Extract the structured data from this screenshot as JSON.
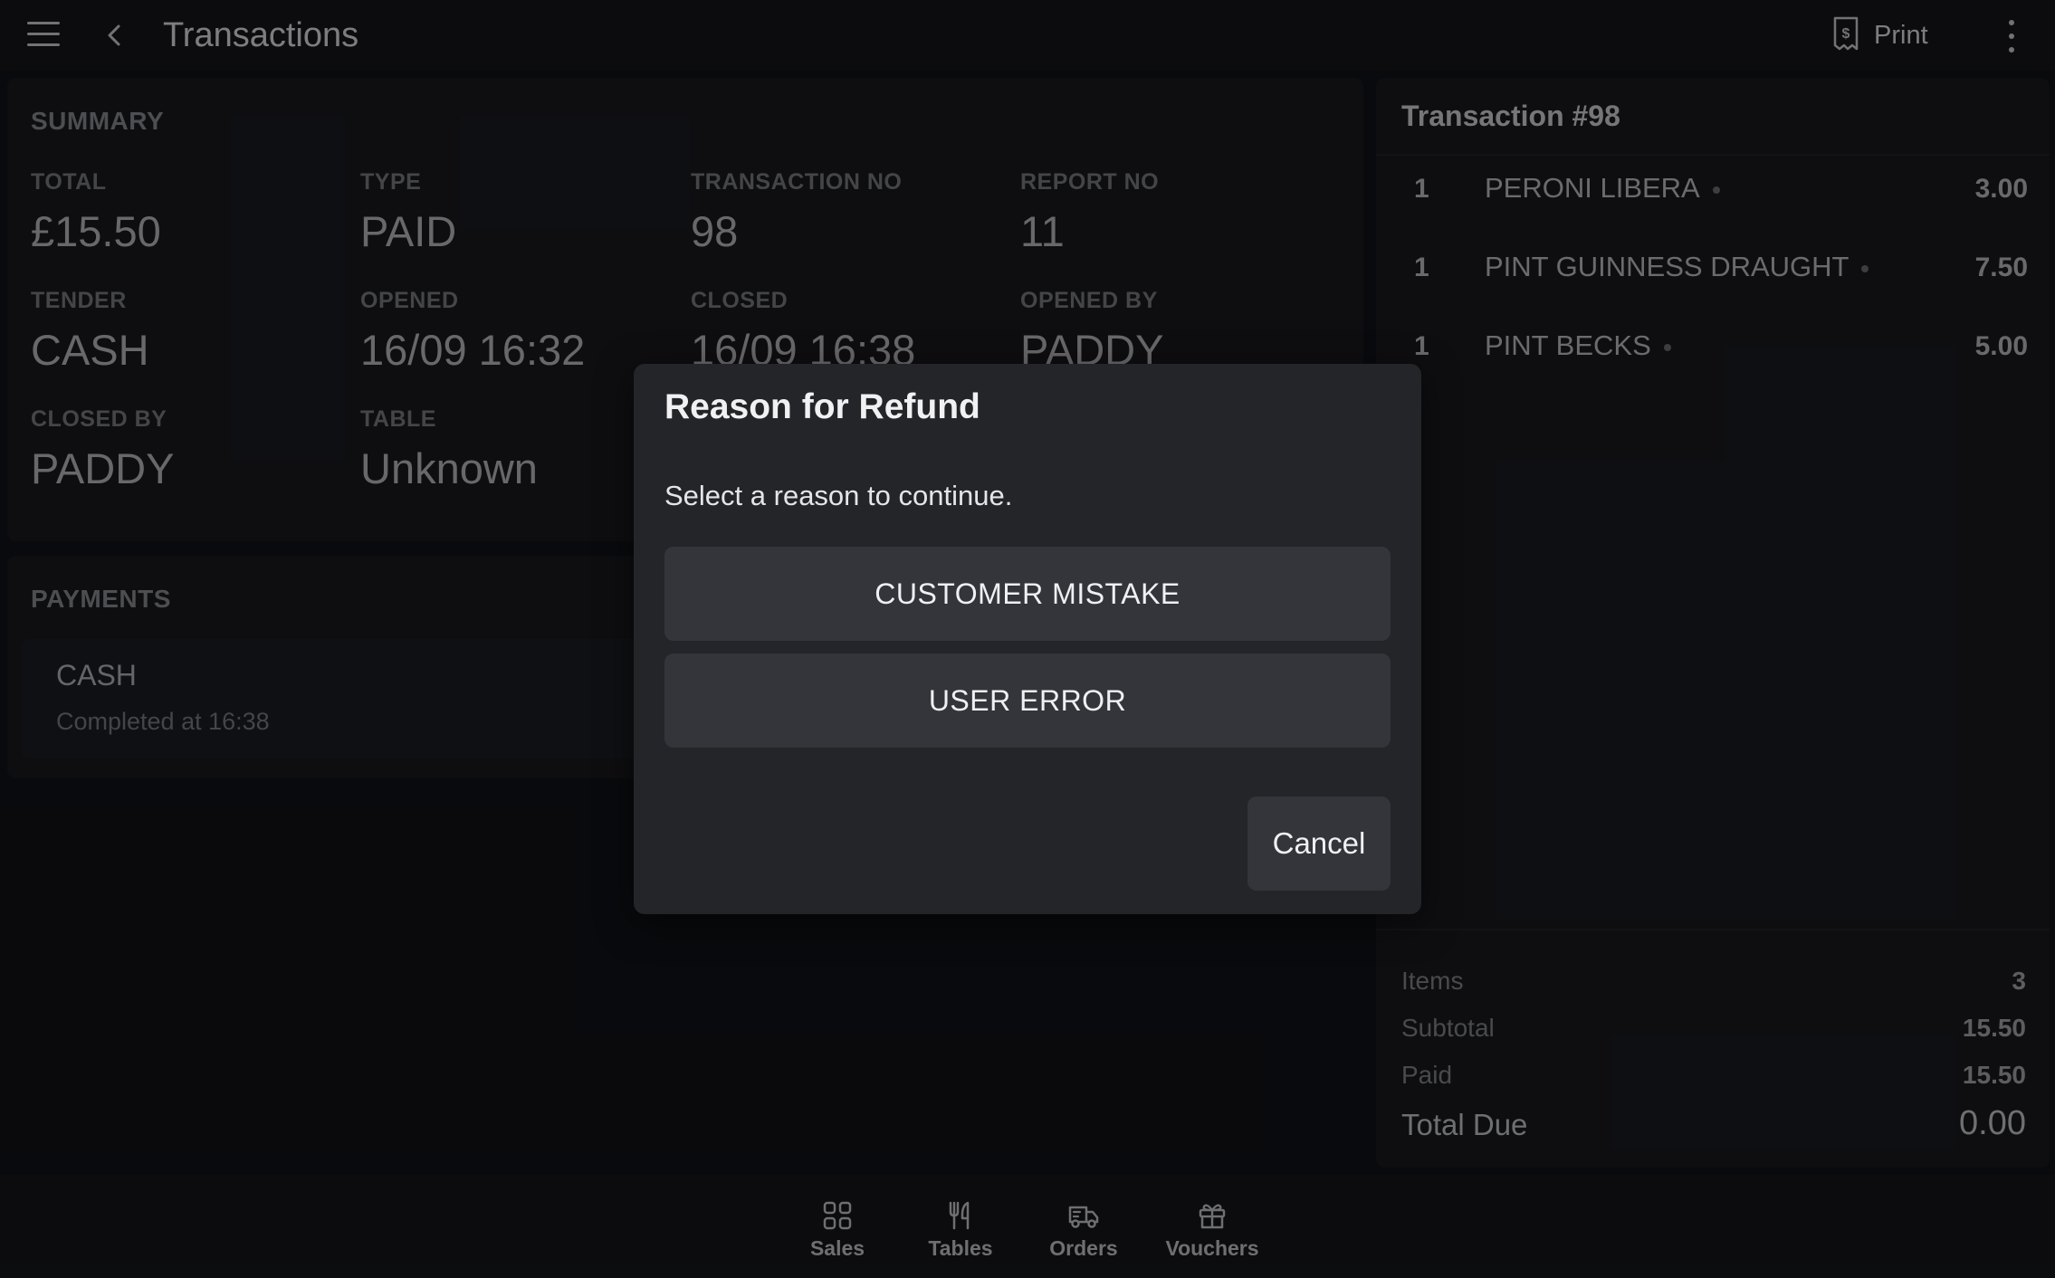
{
  "header": {
    "title": "Transactions",
    "print_label": "Print"
  },
  "summary": {
    "title": "SUMMARY",
    "fields": [
      {
        "label": "TOTAL",
        "value": "£15.50"
      },
      {
        "label": "TYPE",
        "value": "PAID"
      },
      {
        "label": "TRANSACTION NO",
        "value": "98"
      },
      {
        "label": "REPORT NO",
        "value": "11"
      },
      {
        "label": "TENDER",
        "value": "CASH"
      },
      {
        "label": "OPENED",
        "value": "16/09 16:32"
      },
      {
        "label": "CLOSED",
        "value": "16/09 16:38"
      },
      {
        "label": "OPENED BY",
        "value": "PADDY"
      },
      {
        "label": "CLOSED BY",
        "value": "PADDY"
      },
      {
        "label": "TABLE",
        "value": "Unknown"
      }
    ]
  },
  "payments": {
    "title": "PAYMENTS",
    "items": [
      {
        "method": "CASH",
        "status": "Completed at 16:38"
      }
    ]
  },
  "transaction": {
    "title": "Transaction #98",
    "lines": [
      {
        "qty": "1",
        "name": "PERONI LIBERA",
        "amount": "3.00"
      },
      {
        "qty": "1",
        "name": "PINT GUINNESS DRAUGHT",
        "amount": "7.50"
      },
      {
        "qty": "1",
        "name": "PINT BECKS",
        "amount": "5.00"
      }
    ],
    "totals": {
      "items_label": "Items",
      "items_value": "3",
      "subtotal_label": "Subtotal",
      "subtotal_value": "15.50",
      "paid_label": "Paid",
      "paid_value": "15.50",
      "due_label": "Total Due",
      "due_value": "0.00"
    }
  },
  "nav": [
    {
      "label": "Sales",
      "icon": "grid-icon"
    },
    {
      "label": "Tables",
      "icon": "cutlery-icon"
    },
    {
      "label": "Orders",
      "icon": "delivery-truck-icon"
    },
    {
      "label": "Vouchers",
      "icon": "gift-icon"
    }
  ],
  "dialog": {
    "title": "Reason for Refund",
    "message": "Select a reason to continue.",
    "reasons": [
      "CUSTOMER MISTAKE",
      "USER ERROR"
    ],
    "cancel_label": "Cancel"
  }
}
